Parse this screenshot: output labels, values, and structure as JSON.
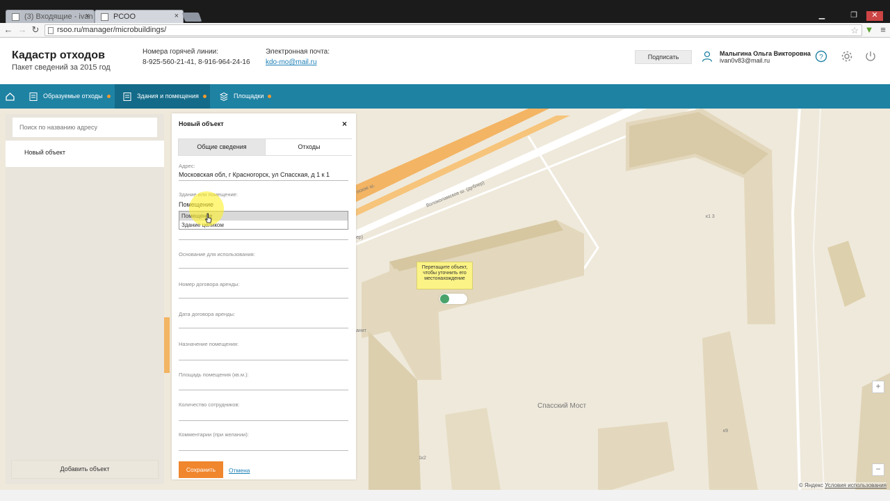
{
  "browser": {
    "tabs": [
      {
        "title": "(3) Входящие - ivan",
        "active": false
      },
      {
        "title": "РСОО",
        "active": true
      }
    ],
    "url": "rsoo.ru/manager/microbuildings/"
  },
  "header": {
    "title": "Кадастр отходов",
    "subtitle": "Пакет сведений за 2015 год",
    "hotline_label": "Номера горячей линии:",
    "hotline_value": "8-925-560-21-41, 8-916-964-24-16",
    "email_label": "Электронная почта:",
    "email_value": "kdo-mo@mail.ru",
    "sign_button": "Подписать",
    "user_name": "Малыгина Ольга Викторовна",
    "user_email": "ivan0v83@mail.ru"
  },
  "nav": {
    "items": [
      {
        "label": "Образуемые отходы"
      },
      {
        "label": "Здания и помещения"
      },
      {
        "label": "Площадки"
      }
    ]
  },
  "sidebar": {
    "search_placeholder": "Поиск по названию адресу",
    "items": [
      "Новый объект"
    ],
    "add_button": "Добавить объект"
  },
  "form": {
    "title": "Новый объект",
    "tabs": [
      "Общие сведения",
      "Отходы"
    ],
    "address_label": "Адрес:",
    "address_value": "Московская обл, г Красногорск, ул Спасская, д 1 к 1",
    "type_label": "Здание или помещение:",
    "type_value": "Помещение",
    "type_options": [
      "Помещение",
      "Здание целиком"
    ],
    "fields": [
      "Основание для использования:",
      "Номер договора аренды:",
      "Дата договора аренды:",
      "Назначение помещения:",
      "Площадь помещения (кв.м.):",
      "Количество сотрудников:",
      "Комментарии (при желании):"
    ],
    "save_button": "Сохранить",
    "cancel_link": "Отмена"
  },
  "map": {
    "tooltip": "Перетащите объект, чтобы уточнить его местонахождение",
    "place_label": "Спасский Мост",
    "road_labels": [
      "Волоколамское ш. (дублер)",
      "оское ш.",
      "ер)",
      "анит"
    ],
    "house_labels": [
      "к1 3",
      "1к2",
      "к9"
    ],
    "zoom_in": "+",
    "zoom_out": "−",
    "attribution_brand": "© Яндекс",
    "attribution_link": "Условия использования"
  },
  "colors": {
    "accent": "#1e82a3",
    "nav_active": "#136b89",
    "save": "#f0862e",
    "link": "#1b7fb6"
  }
}
